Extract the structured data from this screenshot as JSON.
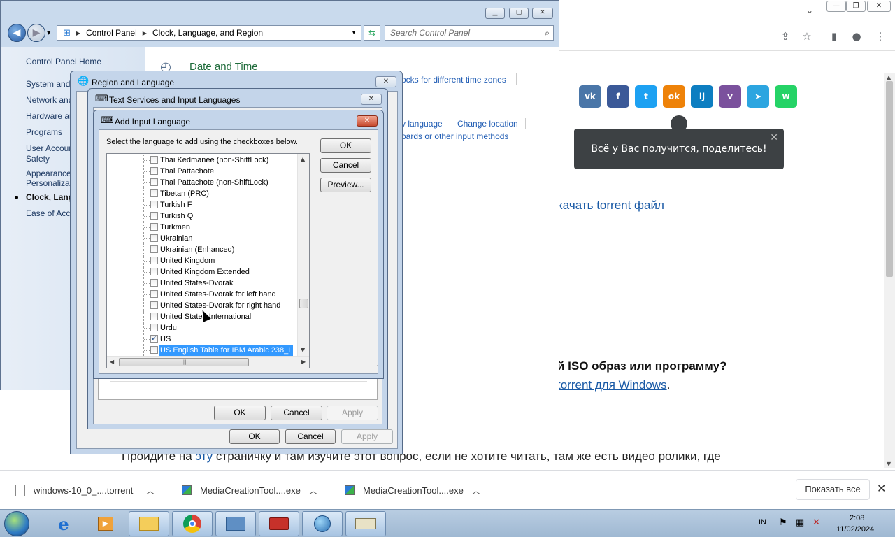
{
  "browser": {
    "page": {
      "share_bubble_text": "Всё у Вас получится, поделитесь!",
      "share_buttons": [
        {
          "name": "vk",
          "glyph": "vk",
          "color": "#4a76a8"
        },
        {
          "name": "facebook",
          "glyph": "f",
          "color": "#3b5998"
        },
        {
          "name": "twitter",
          "glyph": "t",
          "color": "#1da1f2"
        },
        {
          "name": "odnoklassniki",
          "glyph": "ok",
          "color": "#ee8208"
        },
        {
          "name": "livejournal",
          "glyph": "lj",
          "color": "#0d7ec1"
        },
        {
          "name": "viber",
          "glyph": "v",
          "color": "#7b519d"
        },
        {
          "name": "telegram",
          "glyph": "➤",
          "color": "#2ca5e0"
        },
        {
          "name": "whatsapp",
          "glyph": "w",
          "color": "#25d366"
        }
      ],
      "torrent_link": "качать torrent файл",
      "question_heading": "й ISO образ или программу?",
      "torrent_windows_link": "torrent для Windows",
      "period": ".",
      "bottom_text_prefix": "Пройдите на",
      "bottom_link": "эту",
      "bottom_text_suffix": "страничку и там изучите этот вопрос, если не хотите читать, там же есть видео ролики, где"
    }
  },
  "downloads": {
    "items": [
      {
        "name": "windows-10_0_....torrent",
        "type": "file"
      },
      {
        "name": "MediaCreationTool....exe",
        "type": "app"
      },
      {
        "name": "MediaCreationTool....exe",
        "type": "app"
      }
    ],
    "show_all": "Показать все"
  },
  "taskbar": {
    "language": "IN",
    "time": "2:08",
    "date": "11/02/2024"
  },
  "control_panel": {
    "breadcrumb": [
      "Control Panel",
      "Clock, Language, and Region"
    ],
    "search_placeholder": "Search Control Panel",
    "left_items": [
      "Control Panel Home",
      "System and",
      "Network and",
      "Hardware ar",
      "Programs",
      "User Accoun",
      "Safety",
      "Appearance",
      "Personalizat",
      "Clock, Lang",
      "Ease of Acce"
    ],
    "heading": "Date and Time",
    "links": {
      "clocks": "ocks for different time zones",
      "language": "y language",
      "change_location": "Change location",
      "keyboards": "oards or other input methods"
    }
  },
  "region_dialog": {
    "title": "Region and Language",
    "ok": "OK",
    "cancel": "Cancel",
    "apply": "Apply"
  },
  "text_services_dialog": {
    "title": "Text Services and Input Languages",
    "ok": "OK",
    "cancel": "Cancel",
    "apply": "Apply"
  },
  "add_language_dialog": {
    "title": "Add Input Language",
    "instruction": "Select the language to add using the checkboxes below.",
    "ok": "OK",
    "cancel": "Cancel",
    "preview": "Preview...",
    "items": [
      {
        "label": "Thai Kedmanee (non-ShiftLock)",
        "checked": false,
        "selected": false
      },
      {
        "label": "Thai Pattachote",
        "checked": false,
        "selected": false
      },
      {
        "label": "Thai Pattachote (non-ShiftLock)",
        "checked": false,
        "selected": false
      },
      {
        "label": "Tibetan (PRC)",
        "checked": false,
        "selected": false
      },
      {
        "label": "Turkish F",
        "checked": false,
        "selected": false
      },
      {
        "label": "Turkish Q",
        "checked": false,
        "selected": false
      },
      {
        "label": "Turkmen",
        "checked": false,
        "selected": false
      },
      {
        "label": "Ukrainian",
        "checked": false,
        "selected": false
      },
      {
        "label": "Ukrainian (Enhanced)",
        "checked": false,
        "selected": false
      },
      {
        "label": "United Kingdom",
        "checked": false,
        "selected": false
      },
      {
        "label": "United Kingdom Extended",
        "checked": false,
        "selected": false
      },
      {
        "label": "United States-Dvorak",
        "checked": false,
        "selected": false
      },
      {
        "label": "United States-Dvorak for left hand",
        "checked": false,
        "selected": false
      },
      {
        "label": "United States-Dvorak for right hand",
        "checked": false,
        "selected": false
      },
      {
        "label": "United States-International",
        "checked": false,
        "selected": false
      },
      {
        "label": "Urdu",
        "checked": false,
        "selected": false
      },
      {
        "label": "US",
        "checked": true,
        "selected": false
      },
      {
        "label": "US English Table for IBM Arabic 238_L",
        "checked": false,
        "selected": true
      }
    ]
  }
}
